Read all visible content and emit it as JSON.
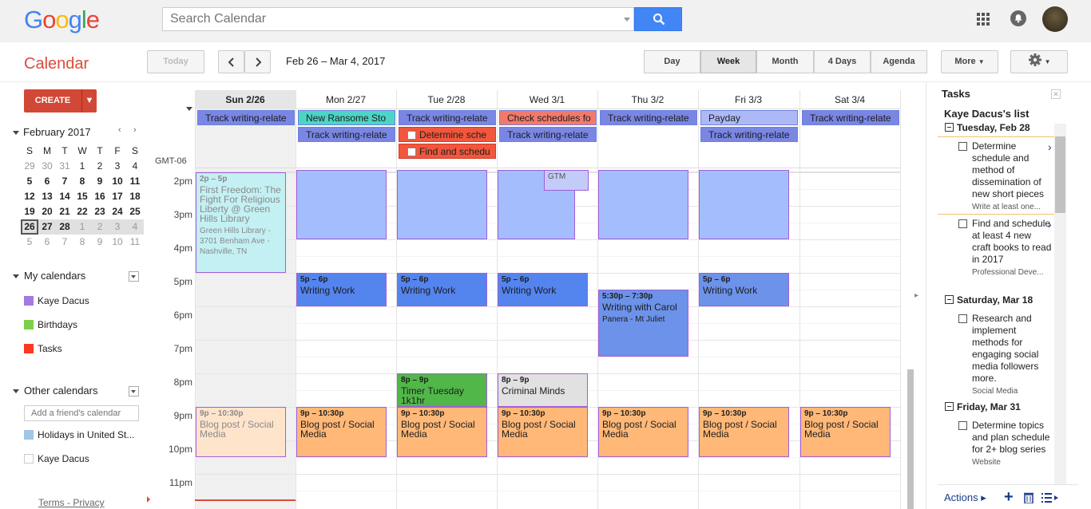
{
  "header": {
    "logo_letters": [
      {
        "ch": "G",
        "color": "#4285f4"
      },
      {
        "ch": "o",
        "color": "#ea4335"
      },
      {
        "ch": "o",
        "color": "#fbbc05"
      },
      {
        "ch": "g",
        "color": "#4285f4"
      },
      {
        "ch": "l",
        "color": "#34a853"
      },
      {
        "ch": "e",
        "color": "#ea4335"
      }
    ],
    "search_placeholder": "Search Calendar",
    "icons": {
      "search": "search-icon",
      "apps": "apps-grid-icon",
      "notifications": "notifications-icon",
      "avatar": "avatar"
    }
  },
  "toolbar": {
    "app_title": "Calendar",
    "today_label": "Today",
    "date_range": "Feb 26 – Mar 4, 2017",
    "views": [
      "Day",
      "Week",
      "Month",
      "4 Days",
      "Agenda"
    ],
    "selected_view": "Week",
    "more_label": "More",
    "icons": {
      "prev": "chevron-left-icon",
      "next": "chevron-right-icon",
      "settings": "gear-icon"
    }
  },
  "sidebar": {
    "create_label": "CREATE",
    "mini_calendar": {
      "month_label": "February 2017",
      "weekday_headers": [
        "S",
        "M",
        "T",
        "W",
        "T",
        "F",
        "S"
      ],
      "weeks": [
        [
          "29",
          "30",
          "31",
          "1",
          "2",
          "3",
          "4"
        ],
        [
          "5",
          "6",
          "7",
          "8",
          "9",
          "10",
          "11"
        ],
        [
          "12",
          "13",
          "14",
          "15",
          "16",
          "17",
          "18"
        ],
        [
          "19",
          "20",
          "21",
          "22",
          "23",
          "24",
          "25"
        ],
        [
          "26",
          "27",
          "28",
          "1",
          "2",
          "3",
          "4"
        ],
        [
          "5",
          "6",
          "7",
          "8",
          "9",
          "10",
          "11"
        ]
      ]
    },
    "my_calendars_label": "My calendars",
    "my_calendars": [
      {
        "name": "Kaye Dacus",
        "color": "#a479e2"
      },
      {
        "name": "Birthdays",
        "color": "#7bd148"
      },
      {
        "name": "Tasks",
        "color": "#f83a22"
      }
    ],
    "other_calendars_label": "Other calendars",
    "friend_placeholder": "Add a friend's calendar",
    "other_calendars": [
      {
        "name": "Holidays in United St...",
        "color": "#9fc6e7"
      },
      {
        "name": "Kaye Dacus",
        "color": "#ffffff"
      }
    ],
    "terms_label": "Terms",
    "privacy_label": "Privacy",
    "terms_separator": " - "
  },
  "grid": {
    "timezone": "GMT-06",
    "days": [
      {
        "label": "Sun 2/26",
        "today": true
      },
      {
        "label": "Mon 2/27"
      },
      {
        "label": "Tue 2/28"
      },
      {
        "label": "Wed 3/1"
      },
      {
        "label": "Thu 3/2"
      },
      {
        "label": "Fri 3/3"
      },
      {
        "label": "Sat 3/4"
      }
    ],
    "hours": [
      "2pm",
      "3pm",
      "4pm",
      "5pm",
      "6pm",
      "7pm",
      "8pm",
      "9pm",
      "10pm",
      "11pm"
    ],
    "allday_events": [
      {
        "day": 0,
        "row": 0,
        "title": "Track writing-relate",
        "bg": "#7986e4",
        "color": "#1d1d1d"
      },
      {
        "day": 1,
        "row": 0,
        "title": "New Ransome Sto",
        "bg": "#4cd4c6",
        "color": "#1d1d1d"
      },
      {
        "day": 1,
        "row": 1,
        "title": "Track writing-relate",
        "bg": "#7986e4",
        "color": "#1d1d1d"
      },
      {
        "day": 2,
        "row": 0,
        "title": "Track writing-relate",
        "bg": "#7986e4",
        "color": "#1d1d1d"
      },
      {
        "day": 2,
        "row": 1,
        "title": "Determine sche",
        "bg": "#f2563c",
        "color": "#222",
        "task": true
      },
      {
        "day": 2,
        "row": 2,
        "title": "Find and schedu",
        "bg": "#f2563c",
        "color": "#222",
        "task": true
      },
      {
        "day": 3,
        "row": 0,
        "title": "Check schedules fo",
        "bg": "#f37a6a",
        "color": "#1d1d1d"
      },
      {
        "day": 3,
        "row": 1,
        "title": "Track writing-relate",
        "bg": "#7986e4",
        "color": "#1d1d1d"
      },
      {
        "day": 4,
        "row": 0,
        "title": "Track writing-relate",
        "bg": "#7986e4",
        "color": "#1d1d1d"
      },
      {
        "day": 5,
        "row": 0,
        "title": "Payday",
        "bg": "#adb9f7",
        "color": "#1d1d1d"
      },
      {
        "day": 5,
        "row": 1,
        "title": "Track writing-relate",
        "bg": "#7986e4",
        "color": "#1d1d1d"
      },
      {
        "day": 6,
        "row": 0,
        "title": "Track writing-relate",
        "bg": "#7986e4",
        "color": "#1d1d1d"
      }
    ],
    "timed_events": [
      {
        "day": 0,
        "start": 14,
        "end": 17,
        "time": "2p – 5p",
        "title": "First Freedom: The Fight For Religious Liberty @ Green Hills Library",
        "location": "Green Hills Library - 3701 Benham Ave - Nashville, TN",
        "bg": "#c3f0f3",
        "color": "#8a8a8a"
      },
      {
        "day": 1,
        "start": 13.5,
        "end": 16,
        "time": "",
        "title": "",
        "bg": "#a4bdfc",
        "color": "#1d1d1d",
        "full": true
      },
      {
        "day": 2,
        "start": 13.5,
        "end": 16,
        "time": "",
        "title": "",
        "bg": "#a4bdfc",
        "color": "#1d1d1d",
        "full": true
      },
      {
        "day": 3,
        "start": 13.5,
        "end": 16,
        "time": "",
        "title": "",
        "bg": "#a4bdfc",
        "color": "#1d1d1d",
        "narrow": true
      },
      {
        "day": 3,
        "start": 13.5,
        "end": 14.55,
        "time": "",
        "title": "GTM",
        "bg": "#c3ccf8",
        "color": "#555",
        "offset": true
      },
      {
        "day": 4,
        "start": 13.5,
        "end": 16,
        "time": "",
        "title": "",
        "bg": "#a4bdfc",
        "color": "#1d1d1d",
        "full": true
      },
      {
        "day": 5,
        "start": 13.5,
        "end": 16,
        "time": "",
        "title": "",
        "bg": "#a4bdfc",
        "color": "#1d1d1d",
        "full": true
      },
      {
        "day": 1,
        "start": 17,
        "end": 18,
        "time": "5p – 6p",
        "title": "Writing Work",
        "bg": "#5484ed",
        "color": "#1d1d1d"
      },
      {
        "day": 2,
        "start": 17,
        "end": 18,
        "time": "5p – 6p",
        "title": "Writing Work",
        "bg": "#5484ed",
        "color": "#1d1d1d"
      },
      {
        "day": 3,
        "start": 17,
        "end": 18,
        "time": "5p – 6p",
        "title": "Writing Work",
        "bg": "#5484ed",
        "color": "#1d1d1d"
      },
      {
        "day": 4,
        "start": 17.5,
        "end": 19.5,
        "time": "5:30p – 7:30p",
        "title": "Writing with Carol",
        "location": "Panera - Mt Juliet",
        "bg": "#6c92ea",
        "color": "#1d1d1d"
      },
      {
        "day": 5,
        "start": 17,
        "end": 18,
        "time": "5p – 6p",
        "title": "Writing Work",
        "bg": "#6c92ea",
        "color": "#1d1d1d"
      },
      {
        "day": 2,
        "start": 20,
        "end": 21,
        "time": "8p – 9p",
        "title": "Timer Tuesday 1k1hr",
        "bg": "#51b749",
        "color": "#1d1d1d"
      },
      {
        "day": 3,
        "start": 20,
        "end": 21,
        "time": "8p – 9p",
        "title": "Criminal Minds",
        "bg": "#e1e1e1",
        "color": "#1d1d1d"
      },
      {
        "day": 0,
        "start": 21,
        "end": 22.5,
        "time": "9p – 10:30p",
        "title": "Blog post / Social Media",
        "bg": "#ffe4cc",
        "color": "#8a8a8a"
      },
      {
        "day": 1,
        "start": 21,
        "end": 22.5,
        "time": "9p – 10:30p",
        "title": "Blog post / Social Media",
        "bg": "#ffb878",
        "color": "#1d1d1d"
      },
      {
        "day": 2,
        "start": 21,
        "end": 22.5,
        "time": "9p – 10:30p",
        "title": "Blog post / Social Media",
        "bg": "#ffb878",
        "color": "#1d1d1d"
      },
      {
        "day": 3,
        "start": 21,
        "end": 22.5,
        "time": "9p – 10:30p",
        "title": "Blog post / Social Media",
        "bg": "#ffb878",
        "color": "#1d1d1d"
      },
      {
        "day": 4,
        "start": 21,
        "end": 22.5,
        "time": "9p – 10:30p",
        "title": "Blog post / Social Media",
        "bg": "#ffb878",
        "color": "#1d1d1d"
      },
      {
        "day": 5,
        "start": 21,
        "end": 22.5,
        "time": "9p – 10:30p",
        "title": "Blog post / Social Media",
        "bg": "#ffb878",
        "color": "#1d1d1d"
      },
      {
        "day": 6,
        "start": 21,
        "end": 22.5,
        "time": "9p – 10:30p",
        "title": "Blog post / Social Media",
        "bg": "#ffb878",
        "color": "#1d1d1d"
      }
    ]
  },
  "tasks": {
    "panel_title": "Tasks",
    "list_title": "Kaye Dacus's list",
    "groups": [
      {
        "date": "Tuesday, Feb 28",
        "items": [
          {
            "text": "Determine schedule and method of dissemination of new short pieces",
            "note": "Write at least one...",
            "arrow": true
          },
          {
            "text": "Find and schedule at least 4 new craft books to read in 2017",
            "note": "Professional Deve...",
            "arrow": true
          }
        ]
      },
      {
        "date": "Saturday, Mar 18",
        "items": [
          {
            "text": "Research and implement methods for engaging social media followers more.",
            "note": "Social Media"
          }
        ]
      },
      {
        "date": "Friday, Mar 31",
        "items": [
          {
            "text": "Determine topics and plan schedule for 2+ blog series",
            "note": "Website"
          }
        ]
      }
    ],
    "actions_label": "Actions"
  }
}
